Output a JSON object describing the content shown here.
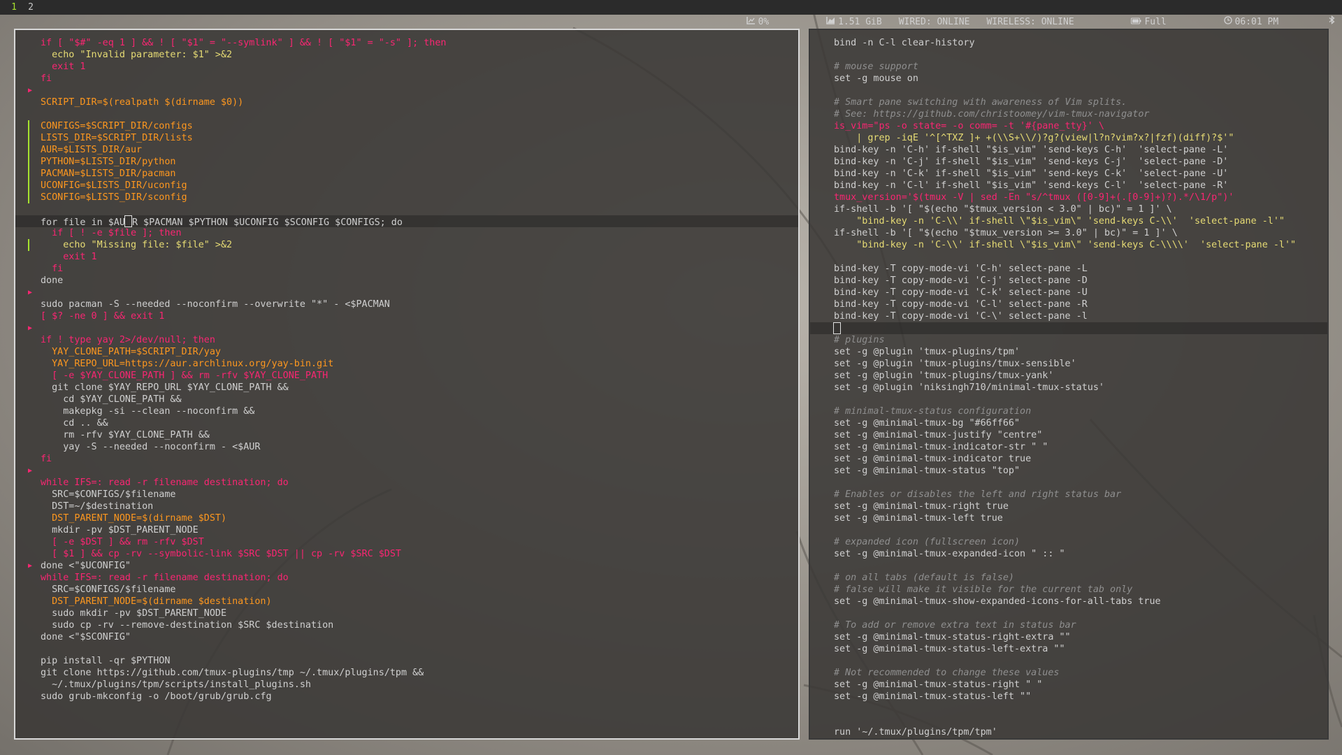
{
  "workspaces": [
    "1",
    "2"
  ],
  "status": {
    "cpu": "0%",
    "memory": "1.51 GiB",
    "wired": "WIRED: ONLINE",
    "wireless": "WIRELESS: ONLINE",
    "battery": "Full",
    "time": "06:01 PM"
  },
  "colors": {
    "accent": "#a6e22e",
    "keyword": "#f92672",
    "string": "#e6db74",
    "variable": "#fd971f",
    "comment": "#8f8f8f",
    "text": "#cfcfcf"
  },
  "left_editor": {
    "lines": [
      {
        "text": "if [ \"$#\" -eq 1 ] && ! [ \"$1\" = \"--symlink\" ] && ! [ \"$1\" = \"-s\" ]; then",
        "hl": "kw"
      },
      {
        "text": "  echo \"Invalid parameter: $1\" >&2",
        "hl": "str"
      },
      {
        "text": "  exit 1",
        "hl": "kw"
      },
      {
        "text": "fi",
        "hl": "kw"
      },
      {
        "text": "",
        "mark": "arrow"
      },
      {
        "text": "SCRIPT_DIR=$(realpath $(dirname $0))",
        "hl": "var"
      },
      {
        "text": ""
      },
      {
        "text": "CONFIGS=$SCRIPT_DIR/configs",
        "hl": "var",
        "mark": "bar"
      },
      {
        "text": "LISTS_DIR=$SCRIPT_DIR/lists",
        "hl": "var",
        "mark": "bar"
      },
      {
        "text": "AUR=$LISTS_DIR/aur",
        "hl": "var",
        "mark": "bar"
      },
      {
        "text": "PYTHON=$LISTS_DIR/python",
        "hl": "var",
        "mark": "bar"
      },
      {
        "text": "PACMAN=$LISTS_DIR/pacman",
        "hl": "var",
        "mark": "bar"
      },
      {
        "text": "UCONFIG=$LISTS_DIR/uconfig",
        "hl": "var",
        "mark": "bar"
      },
      {
        "text": "SCONFIG=$LISTS_DIR/sconfig",
        "hl": "var",
        "mark": "bar"
      },
      {
        "text": ""
      },
      {
        "text": "for file in $AUR $PACMAN $PYTHON $UCONFIG $SCONFIG $CONFIGS; do",
        "current": true,
        "caret_after": "for file in $AU"
      },
      {
        "text": "  if [ ! -e $file ]; then",
        "hl": "kw"
      },
      {
        "text": "    echo \"Missing file: $file\" >&2",
        "hl": "str",
        "mark": "bar"
      },
      {
        "text": "    exit 1",
        "hl": "kw"
      },
      {
        "text": "  fi",
        "hl": "kw"
      },
      {
        "text": "done"
      },
      {
        "text": "",
        "mark": "arrow"
      },
      {
        "text": "sudo pacman -S --needed --noconfirm --overwrite \"*\" - <$PACMAN"
      },
      {
        "text": "[ $? -ne 0 ] && exit 1",
        "hl": "kw"
      },
      {
        "text": "",
        "mark": "arrow"
      },
      {
        "text": "if ! type yay 2>/dev/null; then",
        "hl": "kw"
      },
      {
        "text": "  YAY_CLONE_PATH=$SCRIPT_DIR/yay",
        "hl": "var"
      },
      {
        "text": "  YAY_REPO_URL=https://aur.archlinux.org/yay-bin.git",
        "hl": "var"
      },
      {
        "text": "  [ -e $YAY_CLONE_PATH ] && rm -rfv $YAY_CLONE_PATH",
        "hl": "kw"
      },
      {
        "text": "  git clone $YAY_REPO_URL $YAY_CLONE_PATH &&"
      },
      {
        "text": "    cd $YAY_CLONE_PATH &&"
      },
      {
        "text": "    makepkg -si --clean --noconfirm &&"
      },
      {
        "text": "    cd .. &&"
      },
      {
        "text": "    rm -rfv $YAY_CLONE_PATH &&"
      },
      {
        "text": "    yay -S --needed --noconfirm - <$AUR"
      },
      {
        "text": "fi",
        "hl": "kw"
      },
      {
        "text": "",
        "mark": "arrow"
      },
      {
        "text": "while IFS=: read -r filename destination; do",
        "hl": "kw"
      },
      {
        "text": "  SRC=$CONFIGS/$filename"
      },
      {
        "text": "  DST=~/$destination"
      },
      {
        "text": "  DST_PARENT_NODE=$(dirname $DST)",
        "hl": "var"
      },
      {
        "text": "  mkdir -pv $DST_PARENT_NODE"
      },
      {
        "text": "  [ -e $DST ] && rm -rfv $DST",
        "hl": "kw"
      },
      {
        "text": "  [ $1 ] && cp -rv --symbolic-link $SRC $DST || cp -rv $SRC $DST",
        "hl": "kw"
      },
      {
        "text": "done <\"$UCONFIG\"",
        "mark": "arrow"
      },
      {
        "text": "while IFS=: read -r filename destination; do",
        "hl": "kw"
      },
      {
        "text": "  SRC=$CONFIGS/$filename"
      },
      {
        "text": "  DST_PARENT_NODE=$(dirname $destination)",
        "hl": "var"
      },
      {
        "text": "  sudo mkdir -pv $DST_PARENT_NODE"
      },
      {
        "text": "  sudo cp -rv --remove-destination $SRC $destination"
      },
      {
        "text": "done <\"$SCONFIG\""
      },
      {
        "text": ""
      },
      {
        "text": "pip install -qr $PYTHON"
      },
      {
        "text": "git clone https://github.com/tmux-plugins/tmp ~/.tmux/plugins/tpm &&"
      },
      {
        "text": "  ~/.tmux/plugins/tpm/scripts/install_plugins.sh"
      },
      {
        "text": "sudo grub-mkconfig -o /boot/grub/grub.cfg"
      }
    ]
  },
  "right_editor": {
    "lines": [
      {
        "text": "bind -n C-l clear-history"
      },
      {
        "text": ""
      },
      {
        "text": "# mouse support",
        "hl": "com"
      },
      {
        "text": "set -g mouse on"
      },
      {
        "text": ""
      },
      {
        "text": "# Smart pane switching with awareness of Vim splits.",
        "hl": "com"
      },
      {
        "text": "# See: https://github.com/christoomey/vim-tmux-navigator",
        "hl": "com"
      },
      {
        "text": "is_vim=\"ps -o state= -o comm= -t '#{pane_tty}' \\",
        "hl": "kw"
      },
      {
        "text": "    | grep -iqE '^[^TXZ ]+ +(\\\\S+\\\\/)?g?(view|l?n?vim?x?|fzf)(diff)?$'\"",
        "hl": "str"
      },
      {
        "text": "bind-key -n 'C-h' if-shell \"$is_vim\" 'send-keys C-h'  'select-pane -L'"
      },
      {
        "text": "bind-key -n 'C-j' if-shell \"$is_vim\" 'send-keys C-j'  'select-pane -D'"
      },
      {
        "text": "bind-key -n 'C-k' if-shell \"$is_vim\" 'send-keys C-k'  'select-pane -U'"
      },
      {
        "text": "bind-key -n 'C-l' if-shell \"$is_vim\" 'send-keys C-l'  'select-pane -R'"
      },
      {
        "text": "tmux_version='$(tmux -V | sed -En \"s/^tmux ([0-9]+(.[0-9]+)?).*/\\1/p\")'",
        "hl": "kw"
      },
      {
        "text": "if-shell -b '[ \"$(echo \"$tmux_version < 3.0\" | bc)\" = 1 ]' \\"
      },
      {
        "text": "    \"bind-key -n 'C-\\\\' if-shell \\\"$is_vim\\\" 'send-keys C-\\\\'  'select-pane -l'\"",
        "hl": "str"
      },
      {
        "text": "if-shell -b '[ \"$(echo \"$tmux_version >= 3.0\" | bc)\" = 1 ]' \\"
      },
      {
        "text": "    \"bind-key -n 'C-\\\\' if-shell \\\"$is_vim\\\" 'send-keys C-\\\\\\\\'  'select-pane -l'\"",
        "hl": "str"
      },
      {
        "text": ""
      },
      {
        "text": "bind-key -T copy-mode-vi 'C-h' select-pane -L"
      },
      {
        "text": "bind-key -T copy-mode-vi 'C-j' select-pane -D"
      },
      {
        "text": "bind-key -T copy-mode-vi 'C-k' select-pane -U"
      },
      {
        "text": "bind-key -T copy-mode-vi 'C-l' select-pane -R"
      },
      {
        "text": "bind-key -T copy-mode-vi 'C-\\' select-pane -l"
      },
      {
        "text": "",
        "current": true,
        "caret_after": ""
      },
      {
        "text": "# plugins",
        "hl": "com"
      },
      {
        "text": "set -g @plugin 'tmux-plugins/tpm'"
      },
      {
        "text": "set -g @plugin 'tmux-plugins/tmux-sensible'"
      },
      {
        "text": "set -g @plugin 'tmux-plugins/tmux-yank'"
      },
      {
        "text": "set -g @plugin 'niksingh710/minimal-tmux-status'"
      },
      {
        "text": ""
      },
      {
        "text": "# minimal-tmux-status configuration",
        "hl": "com"
      },
      {
        "text": "set -g @minimal-tmux-bg \"#66ff66\""
      },
      {
        "text": "set -g @minimal-tmux-justify \"centre\""
      },
      {
        "text": "set -g @minimal-tmux-indicator-str \" \""
      },
      {
        "text": "set -g @minimal-tmux-indicator true"
      },
      {
        "text": "set -g @minimal-tmux-status \"top\""
      },
      {
        "text": ""
      },
      {
        "text": "# Enables or disables the left and right status bar",
        "hl": "com"
      },
      {
        "text": "set -g @minimal-tmux-right true"
      },
      {
        "text": "set -g @minimal-tmux-left true"
      },
      {
        "text": ""
      },
      {
        "text": "# expanded icon (fullscreen icon)",
        "hl": "com"
      },
      {
        "text": "set -g @minimal-tmux-expanded-icon \" :: \""
      },
      {
        "text": ""
      },
      {
        "text": "# on all tabs (default is false)",
        "hl": "com"
      },
      {
        "text": "# false will make it visible for the current tab only",
        "hl": "com"
      },
      {
        "text": "set -g @minimal-tmux-show-expanded-icons-for-all-tabs true"
      },
      {
        "text": ""
      },
      {
        "text": "# To add or remove extra text in status bar",
        "hl": "com"
      },
      {
        "text": "set -g @minimal-tmux-status-right-extra \"\""
      },
      {
        "text": "set -g @minimal-tmux-status-left-extra \"\""
      },
      {
        "text": ""
      },
      {
        "text": "# Not recommended to change these values",
        "hl": "com"
      },
      {
        "text": "set -g @minimal-tmux-status-right \" \""
      },
      {
        "text": "set -g @minimal-tmux-status-left \"\""
      },
      {
        "text": ""
      },
      {
        "text": ""
      },
      {
        "text": "run '~/.tmux/plugins/tpm/tpm'"
      }
    ]
  }
}
